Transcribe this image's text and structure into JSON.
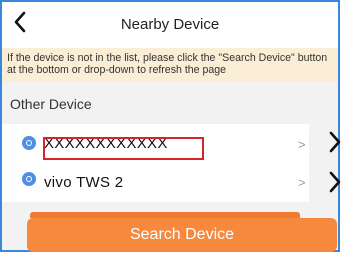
{
  "header": {
    "title": "Nearby Device"
  },
  "notice": {
    "text": "If the device is not in the list, please click the \"Search Device\" button at the bottom or drop-down to refresh the page"
  },
  "section": {
    "title": "Other Device"
  },
  "devices": [
    {
      "name": "XXXXXXXXXXXX",
      "icon": "device-icon",
      "highlighted": true
    },
    {
      "name": "vivo TWS 2",
      "icon": "device-icon",
      "highlighted": false
    }
  ],
  "footer": {
    "search_label": "Search Device"
  },
  "colors": {
    "accent": "#f6893d",
    "notice_bg": "#fbeed7",
    "highlight": "#d8232a",
    "frame": "#3a86d8"
  }
}
